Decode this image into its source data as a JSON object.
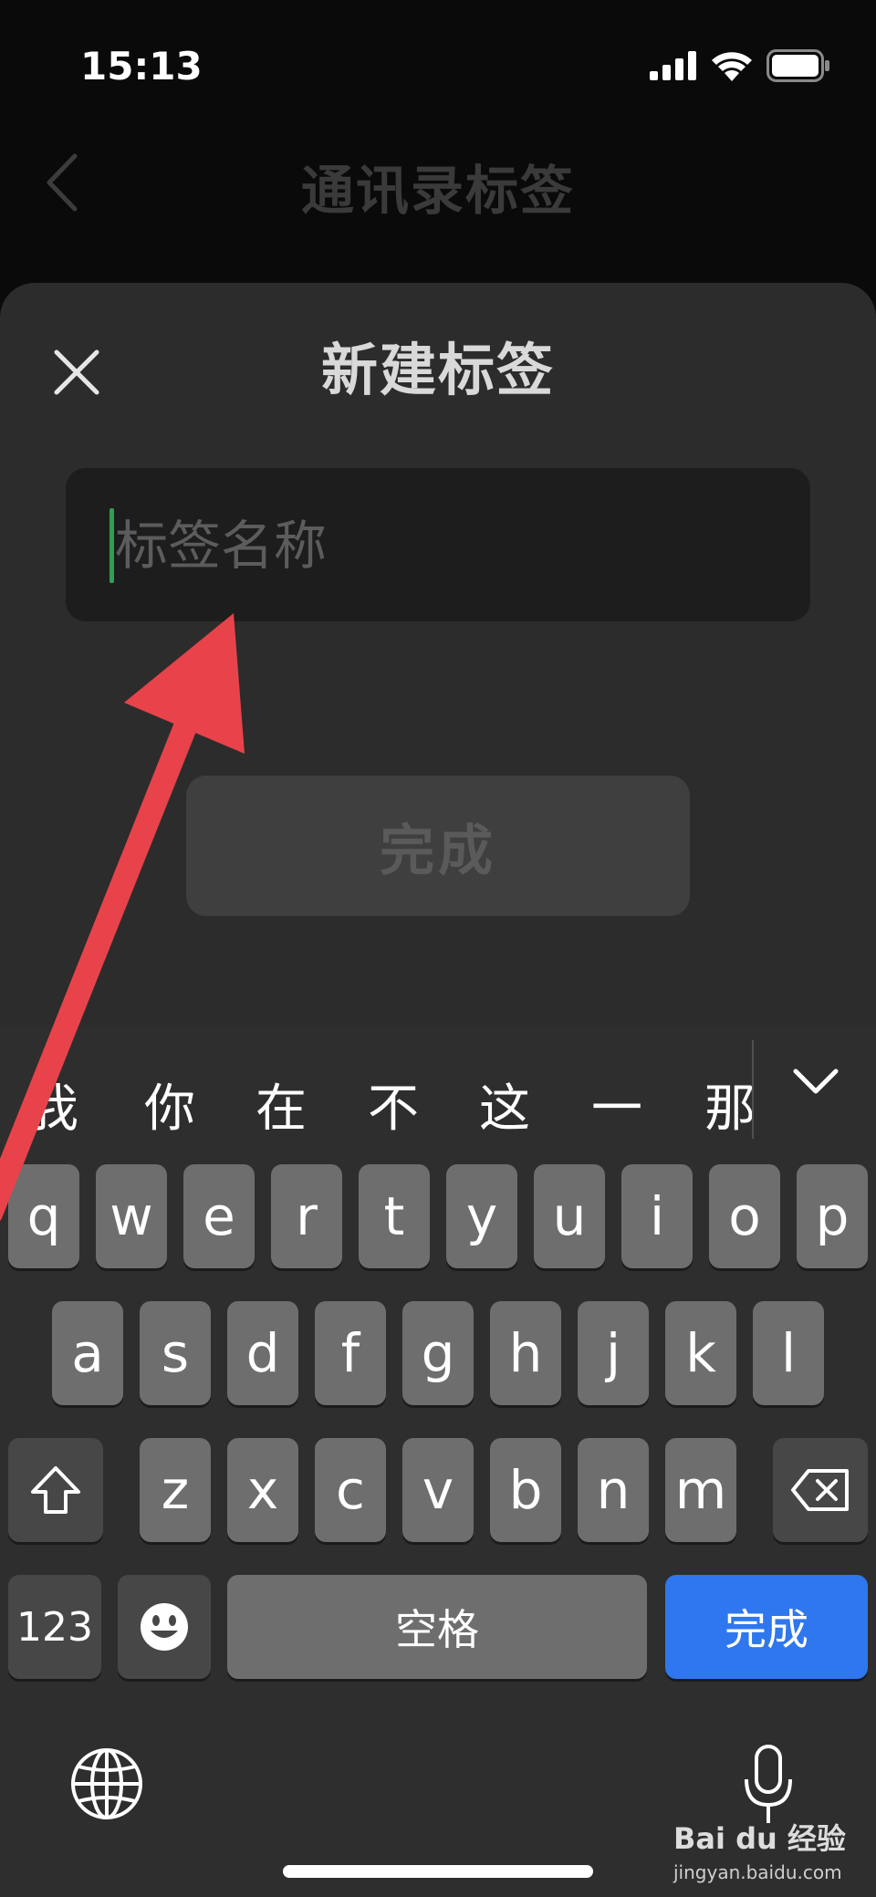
{
  "status_bar": {
    "time": "15:13"
  },
  "nav": {
    "title": "通讯录标签"
  },
  "sheet": {
    "title": "新建标签",
    "input_placeholder": "标签名称",
    "done_label": "完成"
  },
  "keyboard": {
    "candidates": [
      "我",
      "你",
      "在",
      "不",
      "这",
      "一",
      "那"
    ],
    "row1": [
      "q",
      "w",
      "e",
      "r",
      "t",
      "y",
      "u",
      "i",
      "o",
      "p"
    ],
    "row2": [
      "a",
      "s",
      "d",
      "f",
      "g",
      "h",
      "j",
      "k",
      "l"
    ],
    "row3": [
      "z",
      "x",
      "c",
      "v",
      "b",
      "n",
      "m"
    ],
    "num_label": "123",
    "space_label": "空格",
    "done_label": "完成"
  },
  "watermark": {
    "brand": "Bai du 经验",
    "url": "jingyan.baidu.com"
  },
  "colors": {
    "accent_blue": "#2f77ee",
    "cursor_green": "#2f9e54",
    "annotation_red": "#e8434a"
  }
}
